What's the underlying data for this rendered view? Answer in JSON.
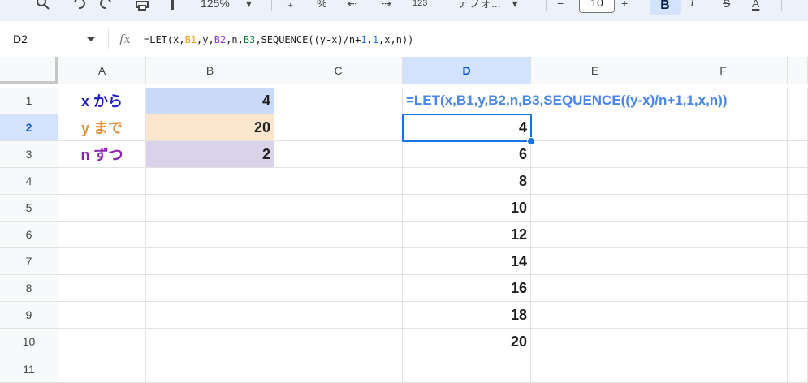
{
  "toolbar": {
    "zoom": "125%",
    "percent": "%",
    "number_format": "123",
    "font_name": "デフォ...",
    "font_size": "10",
    "minus": "−",
    "plus": "+",
    "bold": "B",
    "italic": "I",
    "strike": "S",
    "text_color": "A"
  },
  "formula_bar": {
    "name_box": "D2",
    "fx": "fx",
    "formula_parts": {
      "p1": "=LET(x,",
      "b1": "B1",
      "p2": ",y,",
      "b2": "B2",
      "p3": ",n,",
      "b3": "B3",
      "p4": ",SEQUENCE((y-x)/n+",
      "one1": "1",
      "p5": ",",
      "one2": "1",
      "p6": ",x,n))"
    }
  },
  "columns": [
    "A",
    "B",
    "C",
    "D",
    "E",
    "F"
  ],
  "rows": [
    "1",
    "2",
    "3",
    "4",
    "5",
    "6",
    "7",
    "8",
    "9",
    "10",
    "11"
  ],
  "cells": {
    "A1": "x から",
    "A2": "y まで",
    "A3": "n ずつ",
    "B1": "4",
    "B2": "20",
    "B3": "2",
    "D1": "=LET(x,B1,y,B2,n,B3,SEQUENCE((y-x)/n+1,1,x,n))",
    "D2": "4",
    "D3": "6",
    "D4": "8",
    "D5": "10",
    "D6": "12",
    "D7": "14",
    "D8": "16",
    "D9": "18",
    "D10": "20"
  },
  "colors": {
    "A1_text": "#1a1acc",
    "A2_text": "#e69138",
    "A3_text": "#8e24aa",
    "B1_bg": "#c9daf8",
    "B2_bg": "#fce5cd",
    "B3_bg": "#d9d2e9",
    "D1_text": "#4a86e8",
    "selection": "#1a73e8"
  },
  "selected_cell": "D2"
}
